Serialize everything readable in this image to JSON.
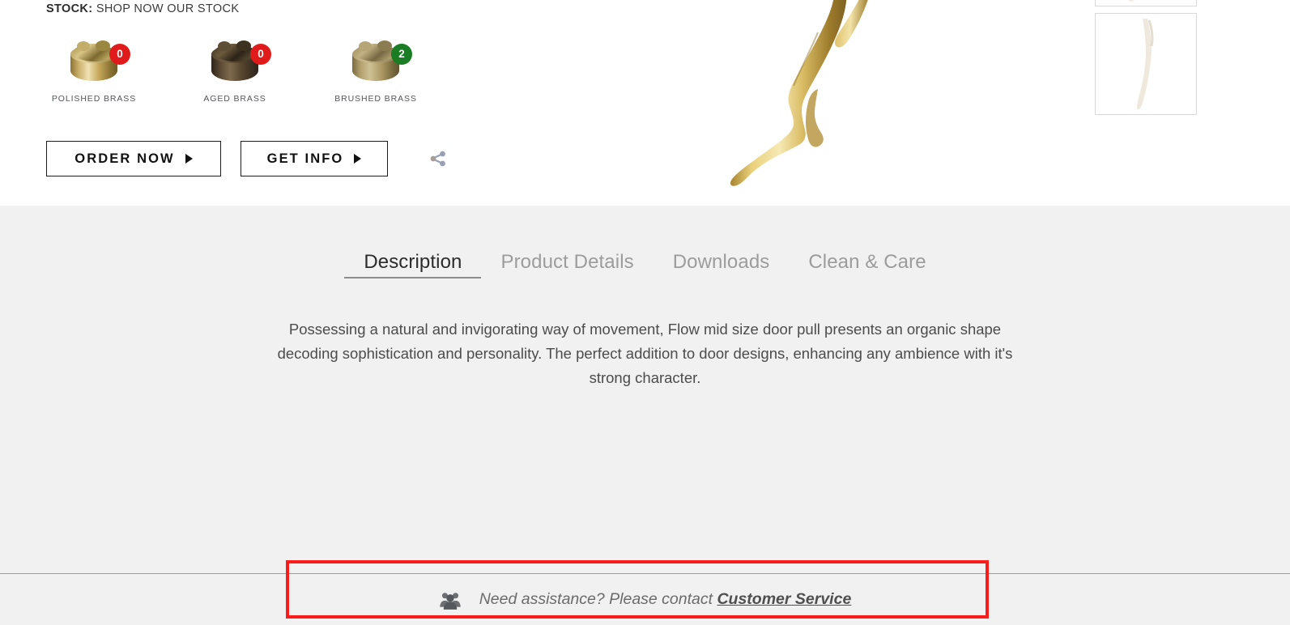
{
  "stock": {
    "label": "STOCK:",
    "value": "SHOP NOW OUR STOCK"
  },
  "finishes": [
    {
      "name": "POLISHED BRASS",
      "count": "0",
      "badge_color": "#e01b1b",
      "swatch": "polished",
      "icon": "brass-cylinder-swatch"
    },
    {
      "name": "AGED BRASS",
      "count": "0",
      "badge_color": "#e01b1b",
      "swatch": "aged",
      "icon": "brass-cylinder-swatch"
    },
    {
      "name": "BRUSHED BRASS",
      "count": "2",
      "badge_color": "#1a7d23",
      "swatch": "brushed",
      "icon": "brass-cylinder-swatch"
    }
  ],
  "actions": {
    "order_now": "ORDER NOW",
    "get_info": "GET INFO",
    "share_icon": "share-icon"
  },
  "gallery": {
    "main_image_alt": "flow-mid-size-door-pull-gold-branch",
    "thumbnails": [
      {
        "alt": "door-pull-thumbnail-1"
      },
      {
        "alt": "door-pull-thumbnail-2"
      }
    ]
  },
  "tabs": [
    {
      "label": "Description",
      "active": true
    },
    {
      "label": "Product Details",
      "active": false
    },
    {
      "label": "Downloads",
      "active": false
    },
    {
      "label": "Clean & Care",
      "active": false
    }
  ],
  "description": "Possessing a natural and invigorating way of movement, Flow mid size door pull presents an organic shape decoding sophistication and personality. The perfect addition to door designs, enhancing any ambience with it's strong character.",
  "assistance": {
    "icon": "people-group-icon",
    "text": "Need assistance? Please contact ",
    "link": "Customer Service"
  },
  "colors": {
    "accent_red": "#e01b1b",
    "accent_green": "#1a7d23",
    "annotation_red": "#fb1b1b",
    "page_grey": "#f1f1f1"
  }
}
